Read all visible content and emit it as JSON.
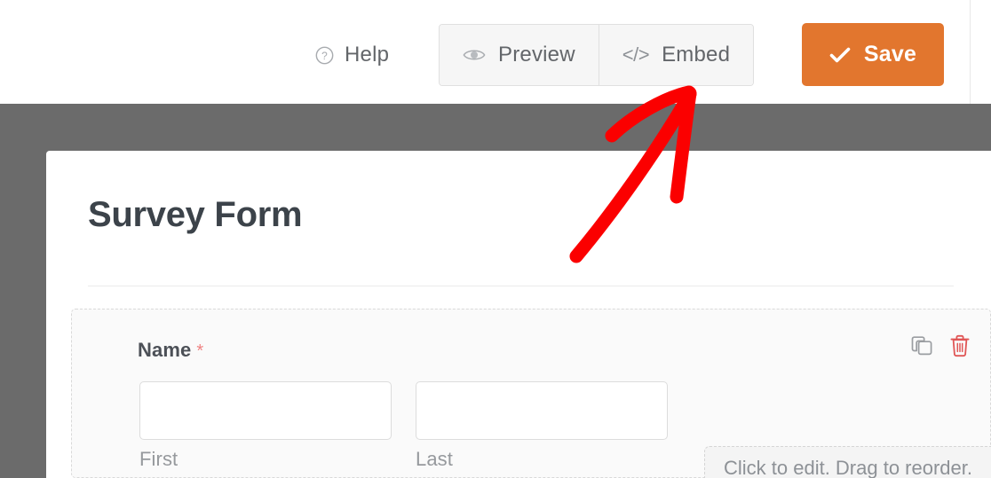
{
  "toolbar": {
    "help_label": "Help",
    "help_icon": "question-circle-icon",
    "preview_label": "Preview",
    "preview_icon": "eye-icon",
    "embed_label": "Embed",
    "embed_icon": "code-brackets-icon",
    "embed_icon_glyph": "</>",
    "save_label": "Save",
    "save_icon": "check-icon",
    "save_color": "#e2762e"
  },
  "form": {
    "title": "Survey Form",
    "backdrop_color": "#6b6b6b",
    "fields": [
      {
        "label": "Name",
        "required_marker": "*",
        "required_color": "#ef8282",
        "duplicate_icon": "duplicate-icon",
        "delete_icon": "trash-icon",
        "delete_color": "#e05656",
        "sub_fields": [
          {
            "label": "First",
            "value": "",
            "placeholder": ""
          },
          {
            "label": "Last",
            "value": "",
            "placeholder": ""
          }
        ]
      }
    ]
  },
  "hint": {
    "text": "Click to edit. Drag to reorder."
  },
  "annotation": {
    "type": "hand-drawn-arrow",
    "color": "#fb0000",
    "points_to": "Embed"
  }
}
